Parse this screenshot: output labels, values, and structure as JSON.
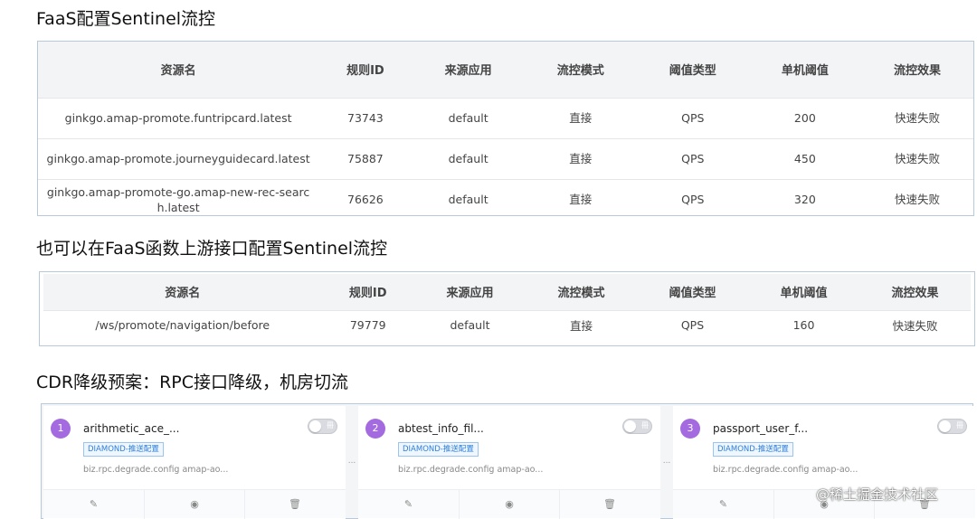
{
  "section1": {
    "heading": "FaaS配置Sentinel流控",
    "columns": [
      "资源名",
      "规则ID",
      "来源应用",
      "流控模式",
      "阈值类型",
      "单机阈值",
      "流控效果"
    ],
    "rows": [
      [
        "ginkgo.amap-promote.funtripcard.latest",
        "73743",
        "default",
        "直接",
        "QPS",
        "200",
        "快速失败"
      ],
      [
        "ginkgo.amap-promote.journeyguidecard.latest",
        "75887",
        "default",
        "直接",
        "QPS",
        "450",
        "快速失败"
      ],
      [
        "ginkgo.amap-promote-go.amap-new-rec-search.latest",
        "76626",
        "default",
        "直接",
        "QPS",
        "320",
        "快速失败"
      ]
    ]
  },
  "section2": {
    "heading": "也可以在FaaS函数上游接口配置Sentinel流控",
    "columns": [
      "资源名",
      "规则ID",
      "来源应用",
      "流控模式",
      "阈值类型",
      "单机阈值",
      "流控效果"
    ],
    "rows": [
      [
        "/ws/promote/navigation/before",
        "79779",
        "default",
        "直接",
        "QPS",
        "160",
        "快速失败"
      ]
    ]
  },
  "section3": {
    "heading": "CDR降级预案：RPC接口降级，机房切流",
    "toggle_label": "冊",
    "gap_dots": "...",
    "cards": [
      {
        "index": "1",
        "title": "arithmetic_ace_...",
        "tag": "DIAMOND-推送配置",
        "desc": "biz.rpc.degrade.config amap-ao..."
      },
      {
        "index": "2",
        "title": "abtest_info_fil...",
        "tag": "DIAMOND-推送配置",
        "desc": "biz.rpc.degrade.config amap-ao..."
      },
      {
        "index": "3",
        "title": "passport_user_f...",
        "tag": "DIAMOND-推送配置",
        "desc": "biz.rpc.degrade.config amap-ao..."
      }
    ],
    "actions": {
      "edit_icon": "✎",
      "view_icon": "◉",
      "delete_icon": "🗑"
    }
  },
  "watermark": "@稀土掘金技术社区",
  "colors": {
    "accent_purple": "#a46ae0",
    "tag_blue": "#2e7fd8",
    "border": "#b9c9dc"
  }
}
